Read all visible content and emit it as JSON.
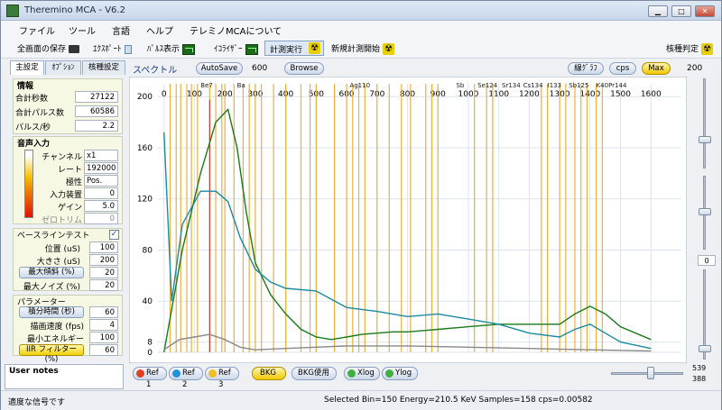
{
  "window": {
    "title": "Theremino MCA - V6.2",
    "minimize": "▁",
    "maximize": "□",
    "close": "✕"
  },
  "menu": [
    "ファイル",
    "ツール",
    "言語",
    "ヘルプ",
    "テレミノMCAについて"
  ],
  "toolbar": {
    "save": "全画面の保存",
    "export": "ｴｸｽﾎﾟｰﾄ",
    "pulse": "ﾊﾟﾙｽ表示",
    "equalizer": "ｲｺﾗｲｻﾞｰ",
    "run": "計測実行",
    "new_measure": "新規計測開始",
    "nuclide": "核種判定"
  },
  "tabs": [
    "主設定",
    "ｵﾌﾟｼｮﾝ",
    "核種設定"
  ],
  "info": {
    "title": "情報",
    "total_sec_label": "合計秒数",
    "total_sec": "27122",
    "total_pulse_label": "合計パルス数",
    "total_pulse": "60586",
    "pps_label": "パルス/秒",
    "pps": "2.2"
  },
  "audio": {
    "title": "音声入力",
    "channel_label": "チャンネル",
    "channel": "x1",
    "rate_label": "レート",
    "rate": "192000",
    "polarity_label": "極性",
    "polarity": "Pos.",
    "input_label": "入力装置",
    "input": "0",
    "gain_label": "ゲイン",
    "gain": "5.0",
    "zero_label": "ゼロトリム",
    "zero": "0"
  },
  "baseline": {
    "title": "ベースラインテスト",
    "checked": "✓",
    "pos_label": "位置 (uS)",
    "pos": "100",
    "size_label": "大きさ (uS)",
    "size": "200",
    "maxslope_label": "最大傾斜 (%)",
    "maxslope": "20",
    "maxnoise_label": "最大ノイズ (%)",
    "maxnoise": "20"
  },
  "params": {
    "title": "パラメーター",
    "integ_label": "積分時間 (秒)",
    "integ": "60",
    "fps_label": "描画速度 (fps)",
    "fps": "4",
    "minenergy_label": "最小エネルギー",
    "minenergy": "100",
    "iir_label": "IIR フィルター (%)",
    "iir": "60"
  },
  "notes": "User notes",
  "plot": {
    "title": "スペクトル",
    "autosave": "AutoSave",
    "autosave_val": "600",
    "browse": "Browse",
    "graph": "線ｸﾞﾗﾌ",
    "cps": "cps",
    "max": "Max",
    "max_val": "200"
  },
  "bottom": {
    "ref1": "Ref 1",
    "ref2": "Ref 2",
    "ref3": "Ref 3",
    "bkg": "BKG",
    "bkg_use": "BKG使用",
    "xlog": "Xlog",
    "ylog": "Ylog",
    "v539": "539",
    "v388": "388",
    "v0": "0"
  },
  "status": {
    "left": "適度な信号です",
    "right": "Selected Bin=150  Energy=210.5 KeV  Samples=158  cps=0.00582"
  },
  "chart_data": {
    "type": "line",
    "x_ticks": [
      0,
      100,
      200,
      300,
      400,
      500,
      600,
      700,
      800,
      900,
      1000,
      1100,
      1200,
      1300,
      1400,
      1500,
      1600
    ],
    "y_ticks": [
      0,
      8,
      40,
      80,
      120,
      160,
      200
    ],
    "nuclide_labels": [
      "Be7",
      "Cs134",
      "I133",
      "Sb125",
      "K40",
      "Pr144",
      "Se124",
      "Sr134",
      "Ag110",
      "Sb",
      "Ba"
    ],
    "series": [
      {
        "color": "#1a7a1a",
        "x": [
          0,
          60,
          120,
          170,
          210,
          240,
          270,
          300,
          350,
          400,
          450,
          500,
          550,
          600,
          650,
          700,
          750,
          800,
          850,
          900,
          1000,
          1100,
          1200,
          1300,
          1350,
          1400,
          1450,
          1500,
          1600
        ],
        "values": [
          0,
          80,
          140,
          180,
          190,
          160,
          110,
          70,
          45,
          30,
          18,
          12,
          10,
          12,
          14,
          15,
          16,
          16,
          17,
          18,
          20,
          22,
          22,
          22,
          30,
          36,
          30,
          20,
          10
        ]
      },
      {
        "color": "#1a8aa0",
        "x": [
          0,
          25,
          60,
          120,
          170,
          210,
          250,
          300,
          350,
          400,
          500,
          600,
          700,
          800,
          900,
          1000,
          1100,
          1200,
          1300,
          1350,
          1400,
          1450,
          1500,
          1600
        ],
        "values": [
          172,
          40,
          100,
          126,
          126,
          118,
          90,
          65,
          55,
          50,
          48,
          35,
          32,
          28,
          30,
          26,
          22,
          15,
          12,
          18,
          22,
          15,
          8,
          3
        ]
      },
      {
        "color": "#888888",
        "x": [
          0,
          50,
          100,
          150,
          200,
          250,
          300,
          400,
          500,
          600,
          800,
          1000,
          1200,
          1400,
          1600
        ],
        "values": [
          2,
          10,
          12,
          14,
          10,
          4,
          2,
          3,
          4,
          5,
          5,
          4,
          3,
          2,
          1
        ]
      }
    ],
    "selected_bin_x": 150
  }
}
